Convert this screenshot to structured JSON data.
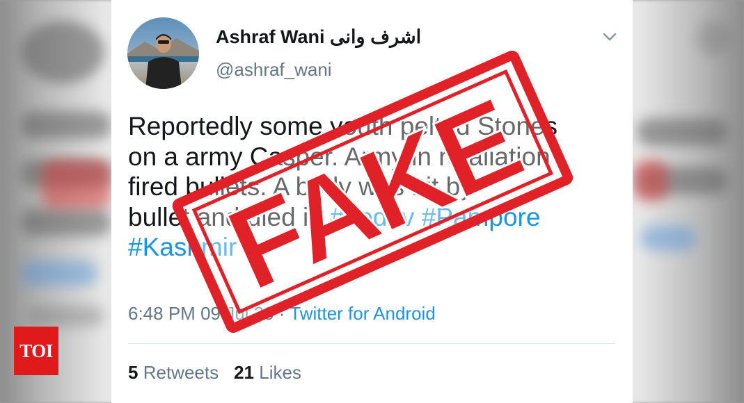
{
  "tweet": {
    "display_name": "Ashraf Wani اشرف وانی",
    "handle": "@ashraf_wani",
    "text_lines": [
      "Reportedly some youth pelted Stones",
      "on a army Casper. Army in retaliation",
      "fired bullets. A body was hit by",
      "bullet and died in "
    ],
    "hashtags_line4": "#Ledov #Pampore",
    "hashtag_line5": "#Kashmir",
    "time": "6:48 PM",
    "date": "09 Jul 20",
    "separator": "·",
    "source": "Twitter for Android",
    "retweets_count": "5",
    "retweets_label": "Retweets",
    "likes_count": "21",
    "likes_label": "Likes"
  },
  "stamp": {
    "text": "FAKE",
    "color": "#e02127"
  },
  "watermark": {
    "text": "TOI",
    "color": "#e01a1a"
  },
  "colors": {
    "link": "#1b95e0",
    "text": "#14171a",
    "muted": "#657786"
  },
  "icons": {
    "menu": "chevron-down-icon"
  }
}
